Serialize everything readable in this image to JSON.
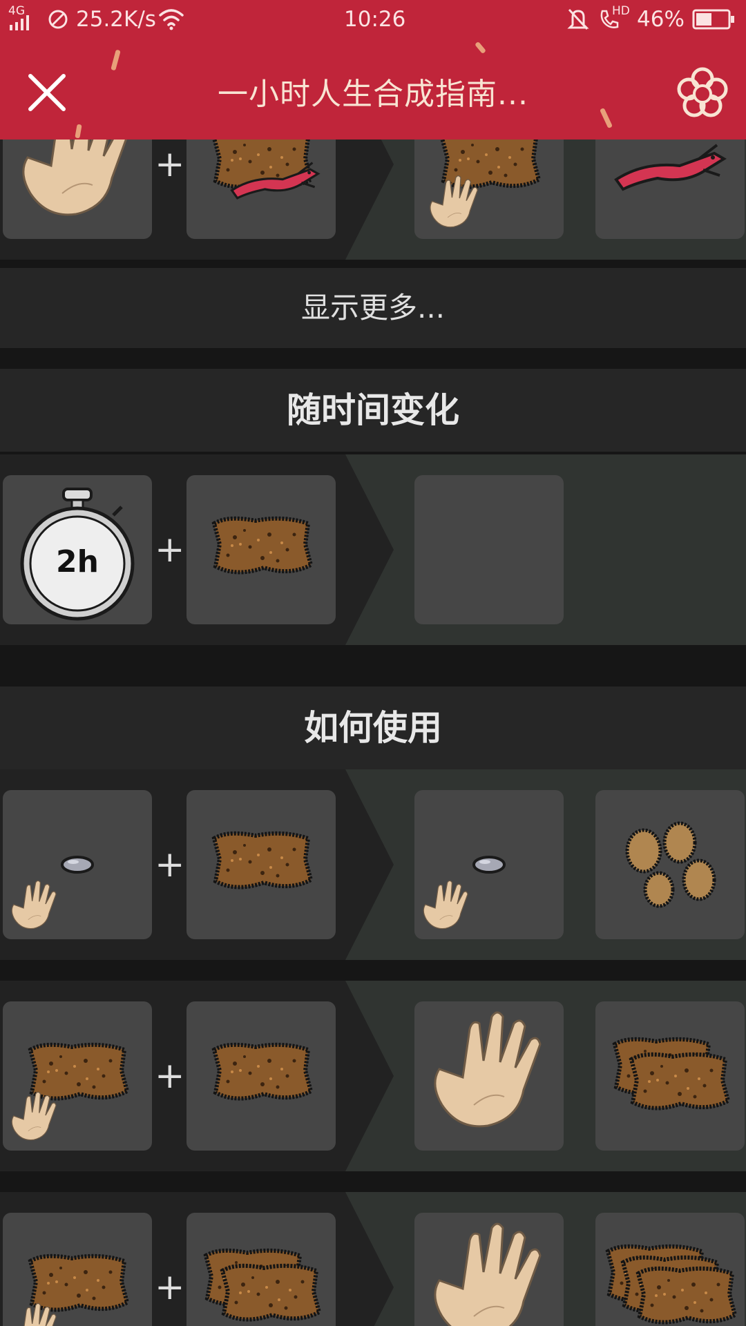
{
  "status_bar": {
    "network": "4G",
    "speed": "25.2K/s",
    "time": "10:26",
    "call_quality": "HD",
    "battery": "46%"
  },
  "header": {
    "title": "一小时人生合成指南..."
  },
  "show_more": "显示更多...",
  "sections": [
    {
      "title": "随时间变化",
      "timer_label": "2h"
    },
    {
      "title": "如何使用"
    }
  ],
  "colors": {
    "brand_red": "#c0253a",
    "background": "#161616",
    "tile": "#464646"
  },
  "icons": [
    "close-icon",
    "flower-icon",
    "hand-icon",
    "fur-pelt-icon",
    "red-lizard-icon",
    "stopwatch-icon",
    "stone-icon",
    "fur-pieces-icon"
  ]
}
